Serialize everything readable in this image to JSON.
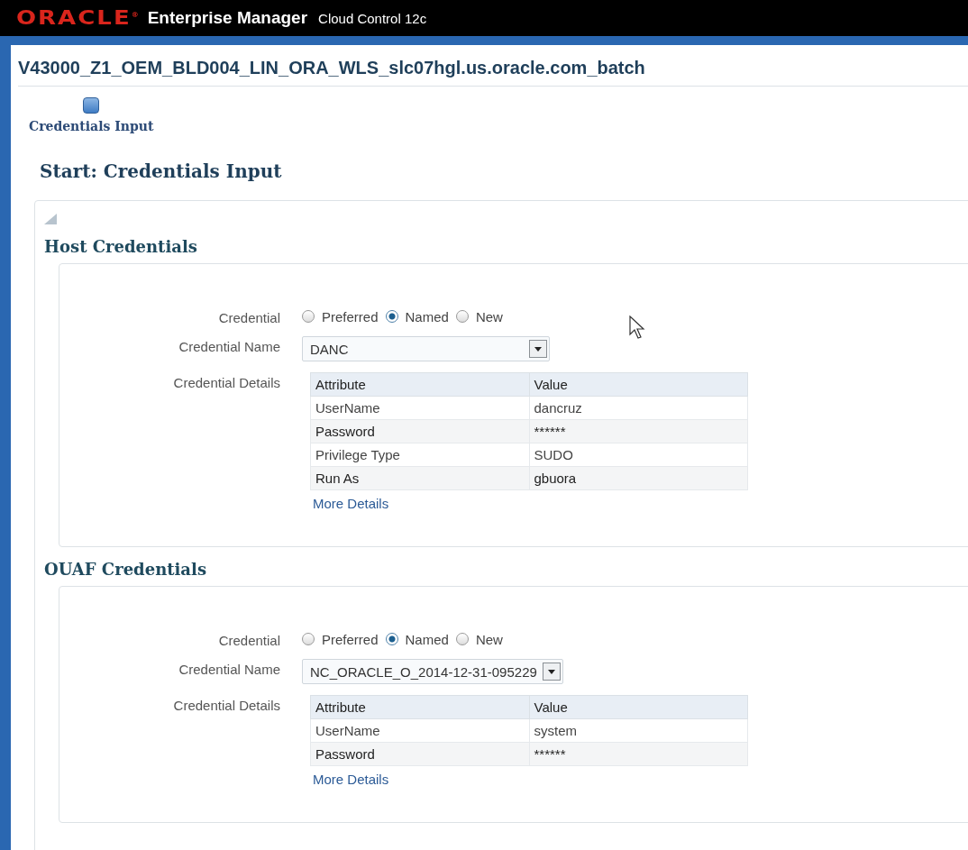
{
  "header": {
    "logo": "ORACLE$^{®}$",
    "product": "Enterprise Manager",
    "edition": "Cloud Control 12c"
  },
  "page_title": "V43000_Z1_OEM_BLD004_LIN_ORA_WLS_slc07hgl.us.oracle.com_batch",
  "train": {
    "steps": [
      {
        "label": "Credentials Input",
        "selected": true
      }
    ]
  },
  "step_title": "Start: Credentials Input",
  "sections": [
    {
      "title": "Host Credentials",
      "credential_label": "Credential",
      "options": [
        {
          "label": "Preferred",
          "selected": false
        },
        {
          "label": "Named",
          "selected": true
        },
        {
          "label": "New",
          "selected": false
        }
      ],
      "name_label": "Credential Name",
      "name_value": "DANC",
      "details_label": "Credential Details",
      "table": {
        "columns": [
          "Attribute",
          "Value"
        ],
        "rows": [
          [
            "UserName",
            "dancruz"
          ],
          [
            "Password",
            "******"
          ],
          [
            "Privilege Type",
            "SUDO"
          ],
          [
            "Run As",
            "gbuora"
          ]
        ]
      },
      "link": "More Details"
    },
    {
      "title": "OUAF Credentials",
      "credential_label": "Credential",
      "options": [
        {
          "label": "Preferred",
          "selected": false
        },
        {
          "label": "Named",
          "selected": true
        },
        {
          "label": "New",
          "selected": false
        }
      ],
      "name_label": "Credential Name",
      "name_value": "NC_ORACLE_O_2014-12-31-095229",
      "details_label": "Credential Details",
      "table": {
        "columns": [
          "Attribute",
          "Value"
        ],
        "rows": [
          [
            "UserName",
            "system"
          ],
          [
            "Password",
            "******"
          ]
        ]
      },
      "link": "More Details"
    }
  ]
}
